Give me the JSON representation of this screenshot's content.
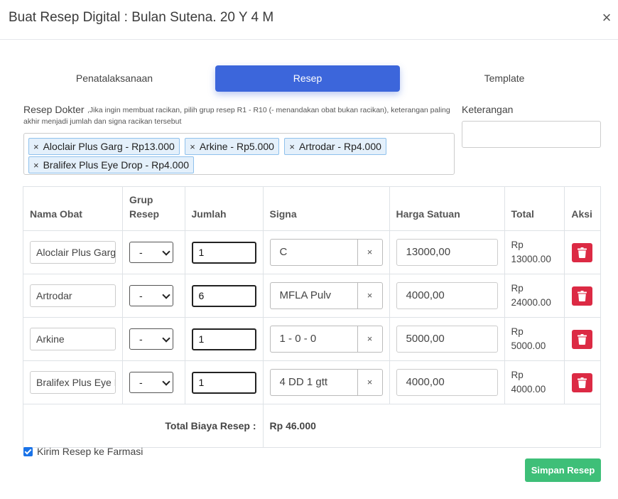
{
  "modal": {
    "title": "Buat Resep Digital : Bulan Sutena. 20 Y 4 M",
    "close_glyph": "×"
  },
  "tabs": [
    {
      "label": "Penatalaksanaan",
      "active": false
    },
    {
      "label": "Resep",
      "active": true
    },
    {
      "label": "Template",
      "active": false
    }
  ],
  "resep": {
    "label": "Resep Dokter",
    "hint": ",Jika ingin membuat racikan, pilih grup resep R1 - R10 (- menandakan obat bukan racikan), keterangan paling akhir menjadi jumlah dan signa racikan tersebut",
    "tags": [
      "Aloclair Plus Garg - Rp13.000",
      "Arkine - Rp5.000",
      "Artrodar - Rp4.000",
      "Bralifex Plus Eye Drop - Rp4.000"
    ],
    "tag_remove_glyph": "×"
  },
  "keterangan": {
    "label": "Keterangan",
    "value": ""
  },
  "table": {
    "headers": [
      "Nama Obat",
      "Grup Resep",
      "Jumlah",
      "Signa",
      "Harga Satuan",
      "Total",
      "Aksi"
    ],
    "rows": [
      {
        "nama": "Aloclair Plus Gargle",
        "grup": "-",
        "jumlah": "1",
        "signa": "C",
        "harga": "13000,00",
        "total_prefix": "Rp",
        "total": "13000.00"
      },
      {
        "nama": "Artrodar",
        "grup": "-",
        "jumlah": "6",
        "signa": "MFLA Pulv",
        "harga": "4000,00",
        "total_prefix": "Rp",
        "total": "24000.00"
      },
      {
        "nama": "Arkine",
        "grup": "-",
        "jumlah": "1",
        "signa": "1 - 0 - 0",
        "harga": "5000,00",
        "total_prefix": "Rp",
        "total": "5000.00"
      },
      {
        "nama": "Bralifex Plus Eye Drop",
        "grup": "-",
        "jumlah": "1",
        "signa": "4 DD 1 gtt",
        "harga": "4000,00",
        "total_prefix": "Rp",
        "total": "4000.00"
      }
    ],
    "signa_clear_glyph": "×",
    "sum_label": "Total Biaya Resep :",
    "sum_value": "Rp 46.000"
  },
  "kirim": {
    "label": "Kirim Resep ke Farmasi",
    "checked": true
  },
  "save_label": "Simpan Resep",
  "colors": {
    "primary": "#3c66db",
    "success": "#3ebf78",
    "danger": "#dc2a44",
    "tag_bg": "#e4f0fb"
  },
  "icons": {
    "delete": "trash-icon",
    "checkbox": "check-icon"
  }
}
